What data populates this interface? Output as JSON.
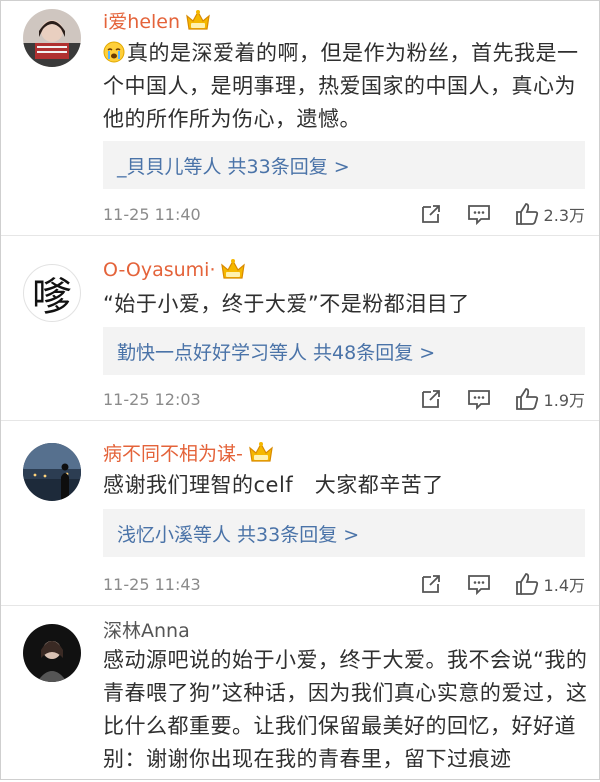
{
  "comments": [
    {
      "username": "i爱helen",
      "text": "真的是深爱着的啊，但是作为粉丝，首先我是一个中国人，是明事理，热爱国家的中国人，真心为他的所作所为伤心，遗憾。",
      "replies": "_貝貝儿等人  共33条回复 >",
      "time": "11-25 11:40",
      "likes": "2.3万"
    },
    {
      "username": "O-Oyasumi·",
      "avatar_text": "嗲",
      "text": "“始于小爱，终于大爱”不是粉都泪目了",
      "replies": "勤快一点好好学习等人  共48条回复 >",
      "time": "11-25 12:03",
      "likes": "1.9万"
    },
    {
      "username": "病不同不相为谋-",
      "text": "感谢我们理智的celf　大家都辛苦了",
      "replies": "浅忆小溪等人  共33条回复 >",
      "time": "11-25 11:43",
      "likes": "1.4万"
    },
    {
      "username": "深林Anna",
      "text": "感动源吧说的始于小爱，终于大爱。我不会说“我的青春喂了狗”这种话，因为我们真心实意的爱过，这比什么都重要。让我们保留最美好的回忆，好好道别：谢谢你出现在我的青春里，留下过痕迹"
    }
  ],
  "colors": {
    "username": "#e4633a",
    "reply_link": "#4a73a8",
    "reply_bg": "#f3f3f3"
  },
  "icons": [
    "crying-emoji-icon",
    "crown-badge-icon",
    "repost-icon",
    "comment-icon",
    "like-icon"
  ]
}
